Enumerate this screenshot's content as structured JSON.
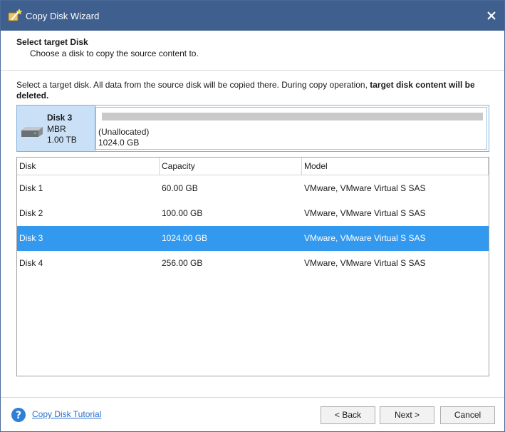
{
  "window": {
    "title": "Copy Disk Wizard"
  },
  "header": {
    "title": "Select target Disk",
    "subtitle": "Choose a disk to copy the source content to."
  },
  "info": {
    "text": "Select a target disk. All data from the source disk will be copied there. During copy operation, ",
    "warning": "target disk content will be deleted."
  },
  "selected_disk": {
    "name": "Disk 3",
    "type": "MBR",
    "size": "1.00 TB",
    "partition_label": "(Unallocated)",
    "partition_size": "1024.0 GB"
  },
  "table": {
    "columns": [
      "Disk",
      "Capacity",
      "Model"
    ],
    "rows": [
      {
        "disk": "Disk 1",
        "capacity": "60.00 GB",
        "model": "VMware, VMware Virtual S SAS",
        "selected": false
      },
      {
        "disk": "Disk 2",
        "capacity": "100.00 GB",
        "model": "VMware, VMware Virtual S SAS",
        "selected": false
      },
      {
        "disk": "Disk 3",
        "capacity": "1024.00 GB",
        "model": "VMware, VMware Virtual S SAS",
        "selected": true
      },
      {
        "disk": "Disk 4",
        "capacity": "256.00 GB",
        "model": "VMware, VMware Virtual S SAS",
        "selected": false
      }
    ]
  },
  "footer": {
    "tutorial_link": "Copy Disk Tutorial",
    "back_label": "< Back",
    "next_label": "Next >",
    "cancel_label": "Cancel"
  },
  "icons": {
    "app": "wizard-wand-icon",
    "close": "close-icon",
    "disk": "hard-disk-icon",
    "help": "help-question-icon"
  },
  "colors": {
    "titlebar": "#3f5f8f",
    "selection": "#3399ee",
    "disk_panel": "#c9e0f6",
    "link": "#2a6fc9"
  }
}
